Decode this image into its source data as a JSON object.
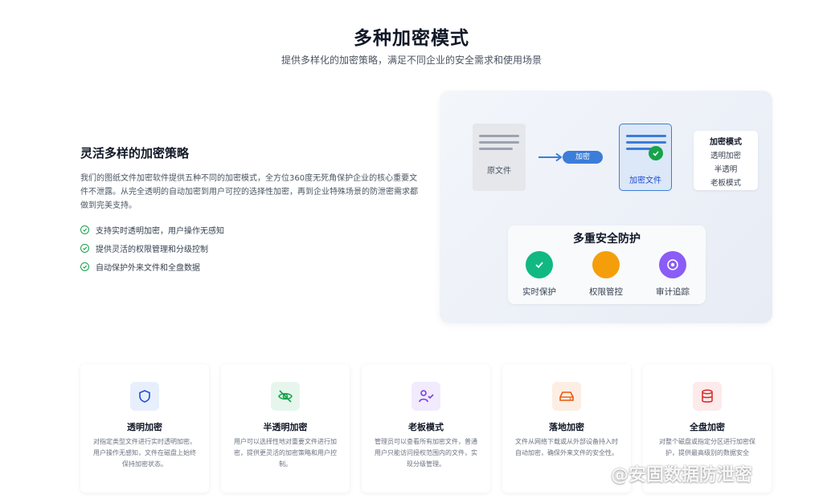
{
  "header": {
    "title": "多种加密模式",
    "subtitle": "提供多样化的加密策略，满足不同企业的安全需求和使用场景"
  },
  "section": {
    "heading": "灵活多样的加密策略",
    "description": "我们的图纸文件加密软件提供五种不同的加密模式，全方位360度无死角保护企业的核心重要文件不泄露。从完全透明的自动加密到用户可控的选择性加密，再到企业特殊场景的防泄密需求都做到完美支持。",
    "features": [
      "支持实时透明加密，用户操作无感知",
      "提供灵活的权限管理和分级控制",
      "自动保护外来文件和全盘数据"
    ]
  },
  "illustration": {
    "original_label": "原文件",
    "encrypt_pill": "加密",
    "encrypted_label": "加密文件",
    "modes_title": "加密模式",
    "modes": [
      "透明加密",
      "半透明",
      "老板模式"
    ],
    "security_title": "多重安全防护",
    "security_items": [
      {
        "label": "实时保护",
        "color": "#10b981",
        "icon": "check-icon"
      },
      {
        "label": "权限管控",
        "color": "#f59e0b",
        "icon": "blank-icon"
      },
      {
        "label": "审计追踪",
        "color": "#8b5cf6",
        "icon": "target-icon"
      }
    ]
  },
  "cards": [
    {
      "title": "透明加密",
      "desc": "对指定类型文件进行实时透明加密。用户操作无感知，文件在磁盘上始终保持加密状态。",
      "icon": "shield-icon",
      "color": "#1d4ed8",
      "bg": "#e8effc"
    },
    {
      "title": "半透明加密",
      "desc": "用户可以选择性地对重要文件进行加密，提供更灵活的加密策略和用户控制。",
      "icon": "eye-off-icon",
      "color": "#16a34a",
      "bg": "#e7f6ec"
    },
    {
      "title": "老板模式",
      "desc": "管理员可以查看所有加密文件，普通用户只能访问授权范围内的文件，实现分级管理。",
      "icon": "user-check-icon",
      "color": "#7c3aed",
      "bg": "#f1ebfd"
    },
    {
      "title": "落地加密",
      "desc": "文件从网络下载或从外部设备持入时自动加密，确保外来文件的安全性。",
      "icon": "hard-drive-icon",
      "color": "#ea580c",
      "bg": "#fdeee4"
    },
    {
      "title": "全盘加密",
      "desc": "对整个磁盘或指定分区进行加密保护，提供最高级别的数据安全",
      "icon": "database-icon",
      "color": "#dc2626",
      "bg": "#fdeaea"
    }
  ],
  "watermark": "@安固数据防泄密"
}
